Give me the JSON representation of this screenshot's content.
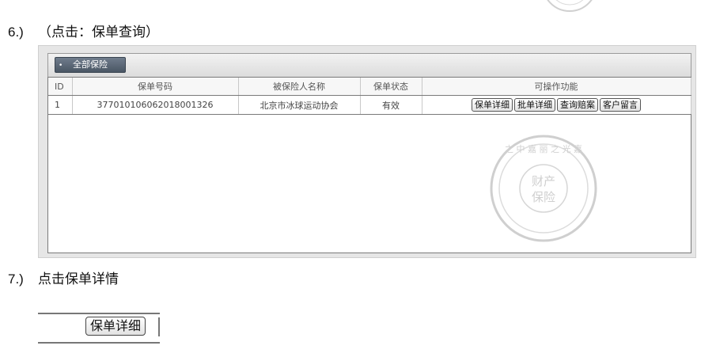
{
  "step6": {
    "num": "6.)",
    "text": "（点击：保单查询）"
  },
  "step7": {
    "num": "7.)",
    "text": "点击保单详情"
  },
  "toolbar": {
    "all_insurance_button": "全部保险"
  },
  "table": {
    "headers": [
      "ID",
      "保单号码",
      "被保险人名称",
      "保单状态",
      "可操作功能"
    ],
    "rows": [
      {
        "id": "1",
        "policy_no": "377010106062018001326",
        "insured_name": "北京市冰球运动协会",
        "status": "有效",
        "actions": [
          "保单详细",
          "批单详细",
          "查询赔案",
          "客户留言"
        ]
      }
    ]
  },
  "snippet": {
    "button": "保单详细"
  },
  "stamp": {
    "center_line1": "财产",
    "center_line2": "保险",
    "ring_text": "之 中 嘉 丽 之 光 嘉"
  }
}
